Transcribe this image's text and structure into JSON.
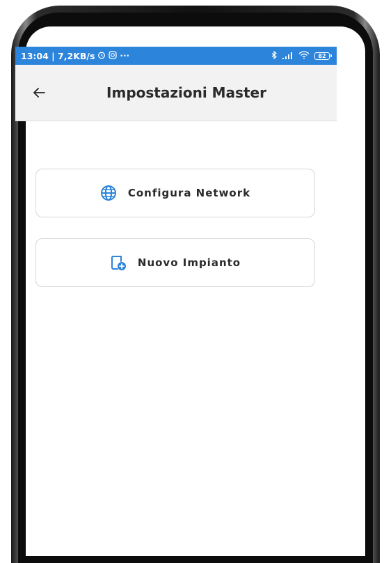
{
  "status_bar": {
    "time_speed": "13:04 | 7,2KB/s",
    "icons_left": [
      "alarm-icon",
      "instagram-icon",
      "more-icon"
    ],
    "icons_right": [
      "bluetooth-icon",
      "signal-icon",
      "wifi-icon",
      "battery-icon"
    ],
    "battery_level": "82",
    "color": "#2c84db"
  },
  "app_bar": {
    "back_icon": "arrow-left-icon",
    "title": "Impostazioni Master"
  },
  "menu": {
    "configure_network": {
      "label": "Configura Network",
      "icon": "globe-icon"
    },
    "new_plant": {
      "label": "Nuovo Impianto",
      "icon": "add-document-icon"
    }
  },
  "accent_color": "#2c84db"
}
